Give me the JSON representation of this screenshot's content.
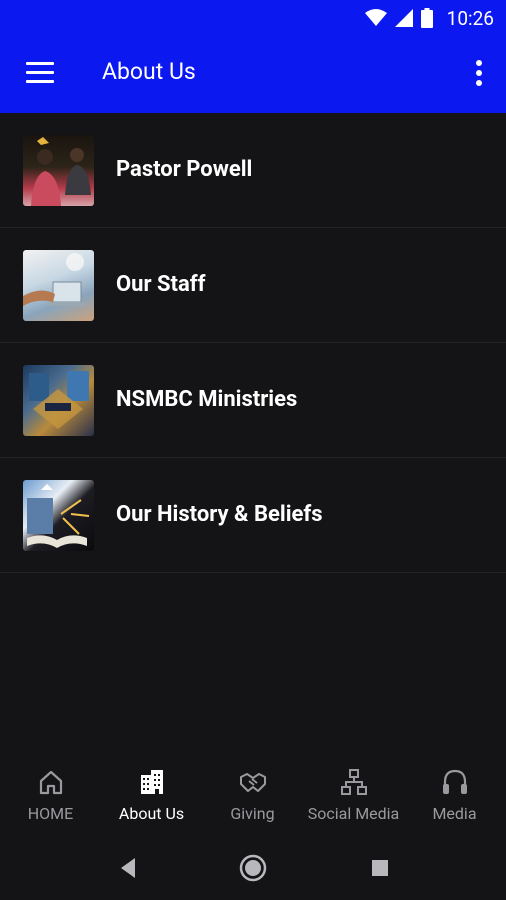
{
  "status_bar": {
    "time": "10:26",
    "icons": [
      "wifi-icon",
      "signal-icon",
      "battery-icon"
    ]
  },
  "app_bar": {
    "title": "About Us",
    "menu_icon": "hamburger-menu-icon",
    "overflow_icon": "more-vert-icon"
  },
  "list": {
    "items": [
      {
        "label": "Pastor Powell",
        "thumbnail": "pastor-photo"
      },
      {
        "label": "Our Staff",
        "thumbnail": "staff-office-photo"
      },
      {
        "label": "NSMBC Ministries",
        "thumbnail": "ministries-photo"
      },
      {
        "label": "Our History & Beliefs",
        "thumbnail": "history-beliefs-photo"
      }
    ]
  },
  "bottom_nav": {
    "items": [
      {
        "label": "HOME",
        "icon": "home-icon",
        "active": false
      },
      {
        "label": "About Us",
        "icon": "building-icon",
        "active": true
      },
      {
        "label": "Giving",
        "icon": "handshake-icon",
        "active": false
      },
      {
        "label": "Social Media",
        "icon": "network-icon",
        "active": false
      },
      {
        "label": "Media",
        "icon": "headphones-icon",
        "active": false
      }
    ]
  },
  "system_nav": {
    "buttons": [
      "back-icon",
      "home-circle-icon",
      "recents-icon"
    ]
  },
  "colors": {
    "app_bar": "#0c18f0",
    "background": "#141416",
    "inactive_label": "#9a9a9e",
    "active_label": "#ffffff"
  }
}
